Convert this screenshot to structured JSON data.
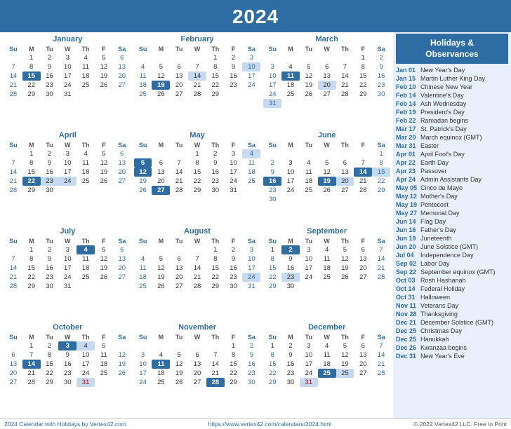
{
  "header": {
    "year": "2024"
  },
  "sidebar": {
    "title": "Holidays &\nObservances",
    "holidays": [
      {
        "date": "Jan 01",
        "name": "New Year's Day"
      },
      {
        "date": "Jan 15",
        "name": "Martin Luther King Day"
      },
      {
        "date": "Feb 10",
        "name": "Chinese New Year"
      },
      {
        "date": "Feb 14",
        "name": "Valentine's Day"
      },
      {
        "date": "Feb 14",
        "name": "Ash Wednesday"
      },
      {
        "date": "Feb 19",
        "name": "President's Day"
      },
      {
        "date": "Feb 22",
        "name": "Ramadan begins"
      },
      {
        "date": "Mar 17",
        "name": "St. Patrick's Day"
      },
      {
        "date": "Mar 20",
        "name": "March equinox (GMT)"
      },
      {
        "date": "Mar 31",
        "name": "Easter"
      },
      {
        "date": "Apr 01",
        "name": "April Fool's Day"
      },
      {
        "date": "Apr 22",
        "name": "Earth Day"
      },
      {
        "date": "Apr 23",
        "name": "Passover"
      },
      {
        "date": "Apr 24",
        "name": "Admin Assistants Day"
      },
      {
        "date": "May 05",
        "name": "Cinco de Mayo"
      },
      {
        "date": "May 12",
        "name": "Mother's Day"
      },
      {
        "date": "May 19",
        "name": "Pentecost"
      },
      {
        "date": "May 27",
        "name": "Memorial Day"
      },
      {
        "date": "Jun 14",
        "name": "Flag Day"
      },
      {
        "date": "Jun 16",
        "name": "Father's Day"
      },
      {
        "date": "Jun 19",
        "name": "Juneteenth"
      },
      {
        "date": "Jun 20",
        "name": "June Solstice (GMT)"
      },
      {
        "date": "Jul 04",
        "name": "Independence Day"
      },
      {
        "date": "Sep 02",
        "name": "Labor Day"
      },
      {
        "date": "Sep 22",
        "name": "September equinox (GMT)"
      },
      {
        "date": "Oct 03",
        "name": "Rosh Hashanah"
      },
      {
        "date": "Oct 14",
        "name": "Federal Holiday"
      },
      {
        "date": "Oct 31",
        "name": "Halloween"
      },
      {
        "date": "Nov 11",
        "name": "Veterans Day"
      },
      {
        "date": "Nov 28",
        "name": "Thanksgiving"
      },
      {
        "date": "Dec 21",
        "name": "December Solstice (GMT)"
      },
      {
        "date": "Dec 25",
        "name": "Christmas Day"
      },
      {
        "date": "Dec 25",
        "name": "Hanukkah"
      },
      {
        "date": "Dec 26",
        "name": "Kwanzaa begins"
      },
      {
        "date": "Dec 31",
        "name": "New Year's Eve"
      }
    ]
  },
  "footer": {
    "left": "2024 Calendar with Holidays by Vertex42.com",
    "center": "https://www.vertex42.com/calendars/2024.html",
    "right": "© 2022 Vertex42 LLC. Free to Print"
  }
}
